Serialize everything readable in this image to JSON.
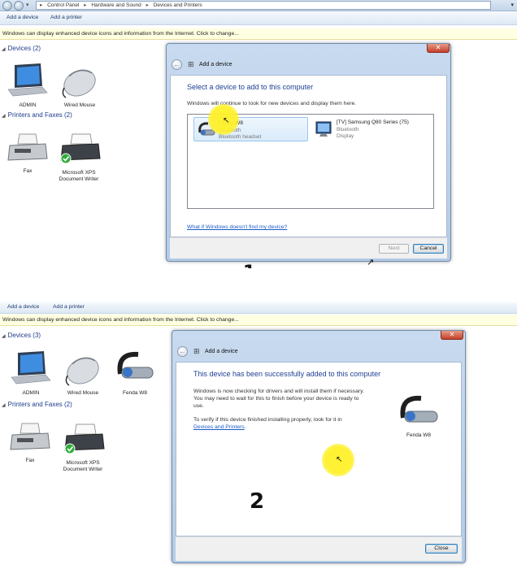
{
  "panel1": {
    "address": {
      "crumbs": [
        "Control Panel",
        "Hardware and Sound",
        "Devices and Printers"
      ],
      "sep": "▸"
    },
    "toolbar": {
      "add_device": "Add a device",
      "add_printer": "Add a printer"
    },
    "infobar": "Windows can display enhanced device icons and information from the Internet. Click to change...",
    "devices_group": "Devices (2)",
    "printers_group": "Printers and Faxes (2)",
    "devices": [
      {
        "label": "ADMIN"
      },
      {
        "label": "Wired Mouse"
      }
    ],
    "printers": [
      {
        "label": "Fax"
      },
      {
        "label": "Microsoft XPS Document Writer"
      }
    ],
    "dialog": {
      "title": "Add a device",
      "heading": "Select a device to add to this computer",
      "subtext": "Windows will continue to look for new devices and display them here.",
      "items": [
        {
          "name": "Fenda W8",
          "type": "Bluetooth",
          "category": "Bluetooth headset"
        },
        {
          "name": "[TV] Samsung Q80 Series (75)",
          "type": "Bluetooth",
          "category": "Display"
        }
      ],
      "help_link": "What if Windows doesn't find my device?",
      "next": "Next",
      "cancel": "Cancel",
      "close": "✕"
    },
    "step": "1"
  },
  "panel2": {
    "toolbar": {
      "add_device": "Add a device",
      "add_printer": "Add a printer"
    },
    "infobar": "Windows can display enhanced device icons and information from the Internet. Click to change...",
    "devices_group": "Devices (3)",
    "printers_group": "Printers and Faxes (2)",
    "devices": [
      {
        "label": "ADMIN"
      },
      {
        "label": "Wired Mouse"
      },
      {
        "label": "Fenda W8"
      }
    ],
    "printers": [
      {
        "label": "Fax"
      },
      {
        "label": "Microsoft XPS Document Writer"
      }
    ],
    "dialog": {
      "title": "Add a device",
      "heading": "This device has been successfully added to this computer",
      "para1": "Windows is now checking for drivers and will install them if necessary. You may need to wait for this to finish before your device is ready to use.",
      "para2_prefix": "To verify if this device finished installing properly, look for it in",
      "para2_link": "Devices and Printers",
      "para2_suffix": ".",
      "device_label": "Fenda W8",
      "close_btn": "Close",
      "close": "✕"
    },
    "step": "2"
  },
  "colors": {
    "heading_blue": "#1e3f93",
    "link_blue": "#1a5cc8",
    "highlight_yellow": "#fff028",
    "infobar_bg": "#ffffe1"
  },
  "icons": [
    "laptop-icon",
    "mouse-icon",
    "fax-icon",
    "printer-icon",
    "headset-icon",
    "display-icon",
    "checkmark-icon",
    "back-arrow-icon",
    "add-device-icon"
  ]
}
